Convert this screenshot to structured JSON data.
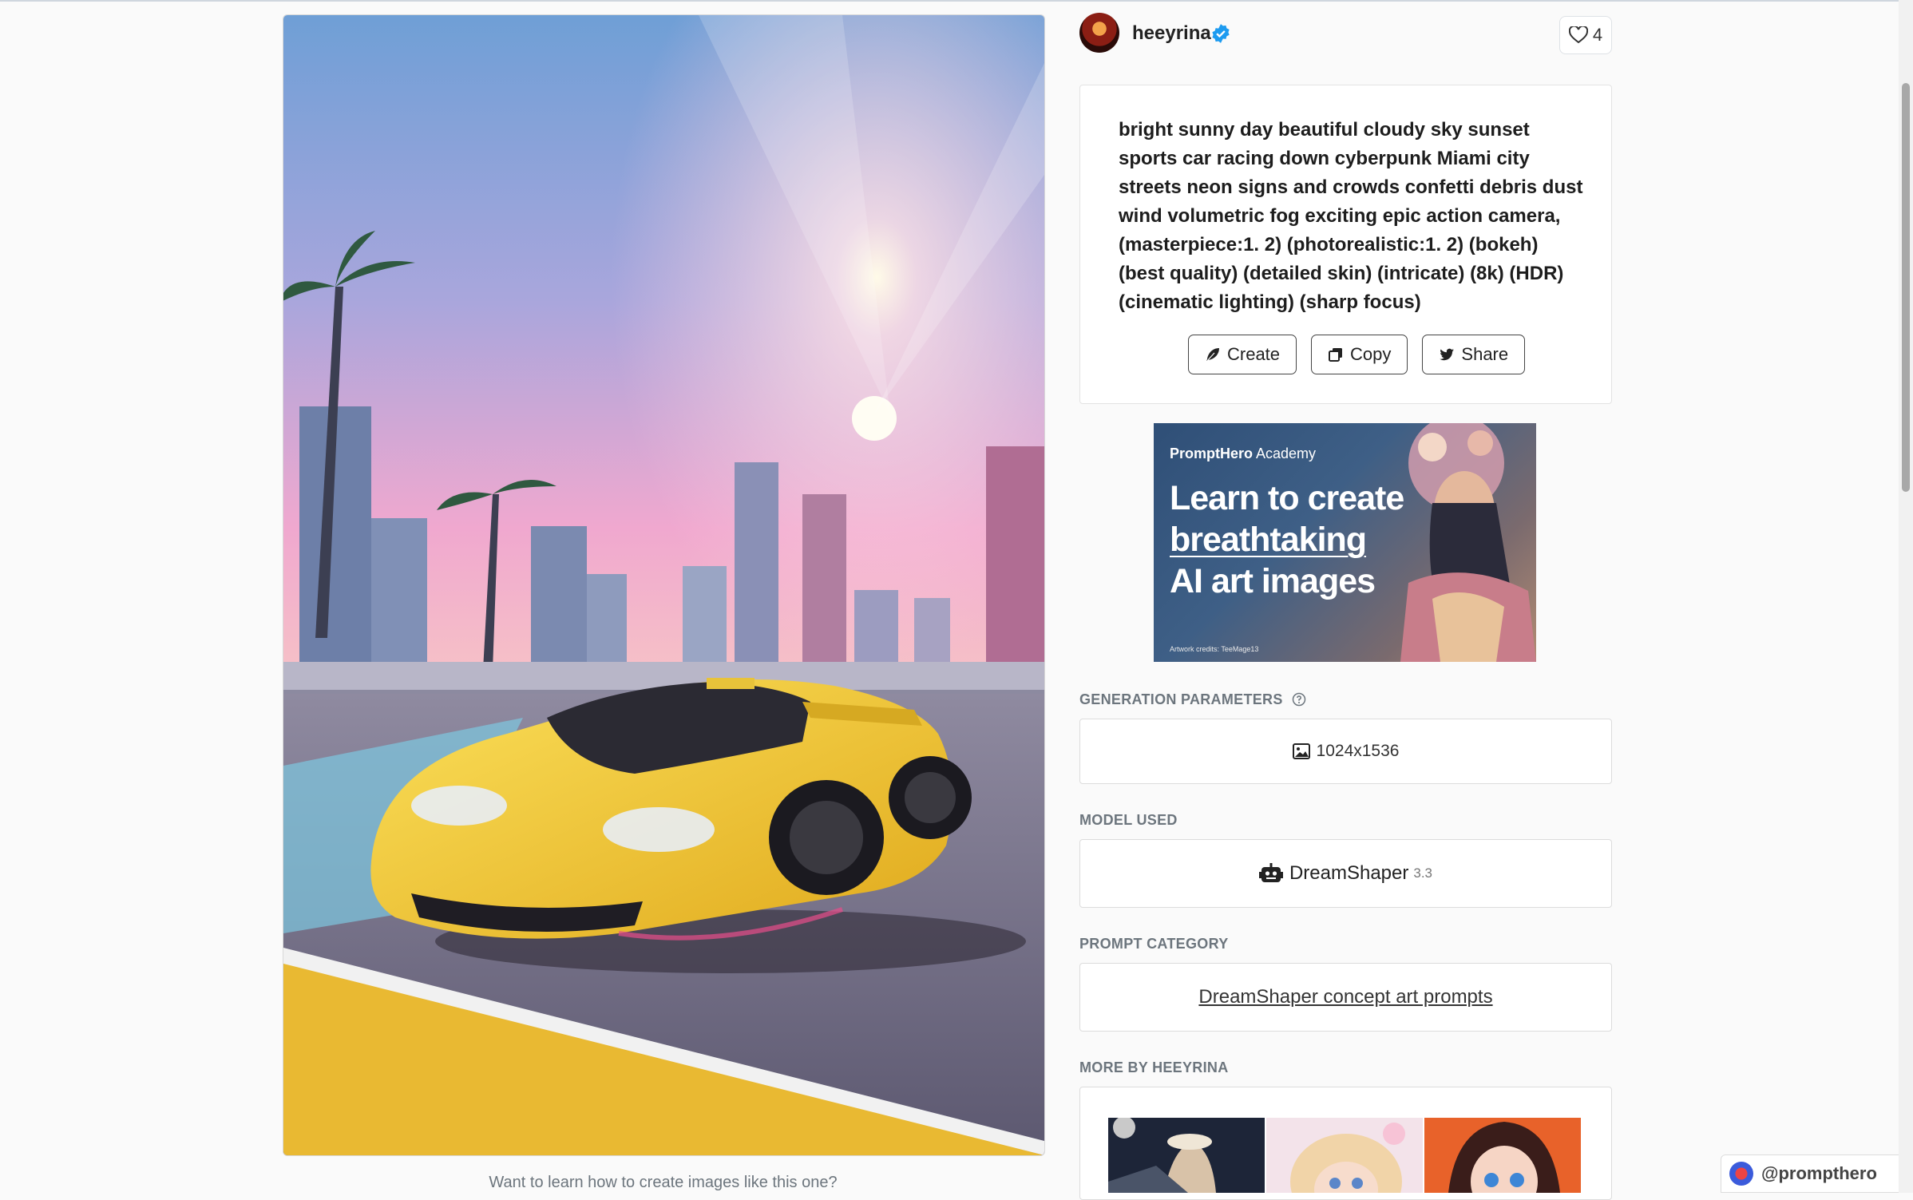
{
  "author": {
    "name": "heeyrina",
    "likes": "4"
  },
  "prompt": "bright sunny day beautiful cloudy sky sunset sports car racing down cyberpunk Miami city streets neon signs and crowds confetti debris dust wind volumetric fog exciting epic action camera, (masterpiece:1. 2) (photorealistic:1. 2) (bokeh) (best quality) (detailed skin) (intricate) (8k) (HDR) (cinematic lighting) (sharp focus)",
  "actions": {
    "create": "Create",
    "copy": "Copy",
    "share": "Share"
  },
  "promo": {
    "brand_bold": "PromptHero",
    "brand_rest": " Academy",
    "line1": "Learn to create",
    "line2": "breathtaking",
    "line3": "AI art images",
    "credits": "Artwork credits: TeeMage13"
  },
  "generation": {
    "label": "GENERATION PARAMETERS",
    "size": "1024x1536"
  },
  "model": {
    "label": "MODEL USED",
    "name": "DreamShaper",
    "version": "3.3"
  },
  "category": {
    "label": "PROMPT CATEGORY",
    "link": "DreamShaper concept art prompts"
  },
  "more": {
    "label": "MORE BY HEEYRINA"
  },
  "below_image_text": "Want to learn how to create images like this one?",
  "watermark": "@prompthero",
  "icons": [
    "verified-icon",
    "heart-icon",
    "feather-icon",
    "copy-icon",
    "twitter-icon",
    "help-icon",
    "image-icon",
    "robot-icon"
  ],
  "colors": {
    "car": "#f2cc2e",
    "verified": "#1d9bf0",
    "sky_top": "#6fa2d8",
    "sky_pink": "#f1a7d0"
  }
}
